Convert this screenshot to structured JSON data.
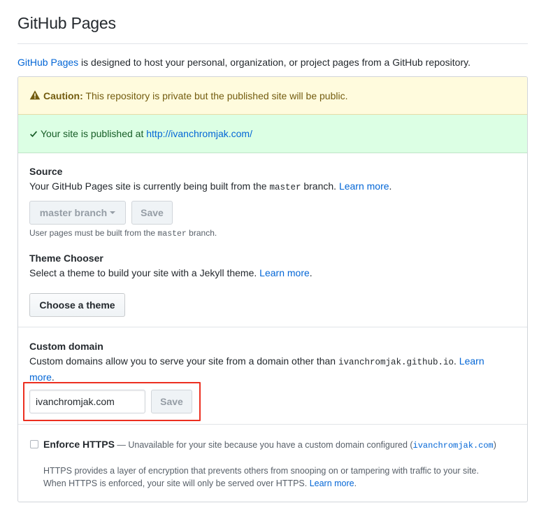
{
  "header": {
    "title": "GitHub Pages"
  },
  "intro": {
    "link": "GitHub Pages",
    "text": " is designed to host your personal, organization, or project pages from a GitHub repository."
  },
  "caution": {
    "label": "Caution:",
    "text": " This repository is private but the published site will be public.",
    "icon": "alert-icon",
    "color": "#735c0f"
  },
  "published": {
    "text": "Your site is published at ",
    "url": "http://ivanchromjak.com/",
    "icon": "check-icon",
    "color": "#165c26"
  },
  "source": {
    "title": "Source",
    "desc_pre": "Your GitHub Pages site is currently being built from the ",
    "branch": "master",
    "desc_post": " branch. ",
    "learn_more": "Learn more",
    "period": ".",
    "select_label": "master branch",
    "save_label": "Save",
    "note_pre": "User pages must be built from the ",
    "note_branch": "master",
    "note_post": " branch."
  },
  "theme": {
    "title": "Theme Chooser",
    "desc": "Select a theme to build your site with a Jekyll theme. ",
    "learn_more": "Learn more",
    "period": ".",
    "button": "Choose a theme"
  },
  "custom_domain": {
    "title": "Custom domain",
    "desc_pre": "Custom domains allow you to serve your site from a domain other than ",
    "domain": "ivanchromjak.github.io",
    "desc_post": ". ",
    "learn_more_1": "Learn",
    "learn_more_2": "more",
    "period": ".",
    "input_value": "ivanchromjak.com",
    "save_label": "Save",
    "highlight_color": "#ec2f20"
  },
  "https": {
    "label": "Enforce HTTPS",
    "dash": " — ",
    "unavailable": "Unavailable for your site because you have a custom domain configured (",
    "domain": "ivanchromjak.com",
    "close": ")",
    "help_line1": "HTTPS provides a layer of encryption that prevents others from snooping on or tampering with traffic to your site.",
    "help_line2": "When HTTPS is enforced, your site will only be served over HTTPS. ",
    "learn_more": "Learn more",
    "period": "."
  },
  "colors": {
    "link": "#0366d6",
    "border": "#d1d5da"
  }
}
